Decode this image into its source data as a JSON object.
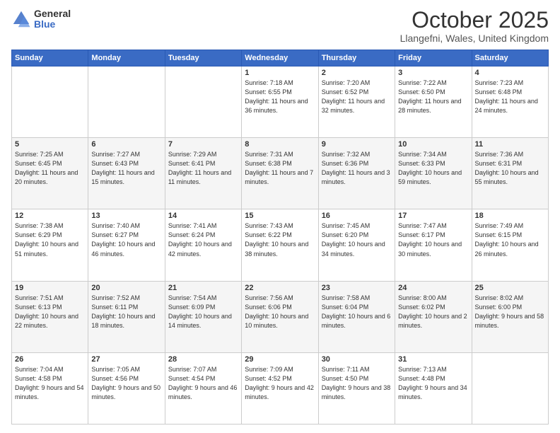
{
  "logo": {
    "general": "General",
    "blue": "Blue"
  },
  "header": {
    "month": "October 2025",
    "location": "Llangefni, Wales, United Kingdom"
  },
  "days_of_week": [
    "Sunday",
    "Monday",
    "Tuesday",
    "Wednesday",
    "Thursday",
    "Friday",
    "Saturday"
  ],
  "weeks": [
    [
      {
        "day": null,
        "sunrise": null,
        "sunset": null,
        "daylight": null
      },
      {
        "day": null,
        "sunrise": null,
        "sunset": null,
        "daylight": null
      },
      {
        "day": null,
        "sunrise": null,
        "sunset": null,
        "daylight": null
      },
      {
        "day": "1",
        "sunrise": "7:18 AM",
        "sunset": "6:55 PM",
        "daylight": "11 hours and 36 minutes."
      },
      {
        "day": "2",
        "sunrise": "7:20 AM",
        "sunset": "6:52 PM",
        "daylight": "11 hours and 32 minutes."
      },
      {
        "day": "3",
        "sunrise": "7:22 AM",
        "sunset": "6:50 PM",
        "daylight": "11 hours and 28 minutes."
      },
      {
        "day": "4",
        "sunrise": "7:23 AM",
        "sunset": "6:48 PM",
        "daylight": "11 hours and 24 minutes."
      }
    ],
    [
      {
        "day": "5",
        "sunrise": "7:25 AM",
        "sunset": "6:45 PM",
        "daylight": "11 hours and 20 minutes."
      },
      {
        "day": "6",
        "sunrise": "7:27 AM",
        "sunset": "6:43 PM",
        "daylight": "11 hours and 15 minutes."
      },
      {
        "day": "7",
        "sunrise": "7:29 AM",
        "sunset": "6:41 PM",
        "daylight": "11 hours and 11 minutes."
      },
      {
        "day": "8",
        "sunrise": "7:31 AM",
        "sunset": "6:38 PM",
        "daylight": "11 hours and 7 minutes."
      },
      {
        "day": "9",
        "sunrise": "7:32 AM",
        "sunset": "6:36 PM",
        "daylight": "11 hours and 3 minutes."
      },
      {
        "day": "10",
        "sunrise": "7:34 AM",
        "sunset": "6:33 PM",
        "daylight": "10 hours and 59 minutes."
      },
      {
        "day": "11",
        "sunrise": "7:36 AM",
        "sunset": "6:31 PM",
        "daylight": "10 hours and 55 minutes."
      }
    ],
    [
      {
        "day": "12",
        "sunrise": "7:38 AM",
        "sunset": "6:29 PM",
        "daylight": "10 hours and 51 minutes."
      },
      {
        "day": "13",
        "sunrise": "7:40 AM",
        "sunset": "6:27 PM",
        "daylight": "10 hours and 46 minutes."
      },
      {
        "day": "14",
        "sunrise": "7:41 AM",
        "sunset": "6:24 PM",
        "daylight": "10 hours and 42 minutes."
      },
      {
        "day": "15",
        "sunrise": "7:43 AM",
        "sunset": "6:22 PM",
        "daylight": "10 hours and 38 minutes."
      },
      {
        "day": "16",
        "sunrise": "7:45 AM",
        "sunset": "6:20 PM",
        "daylight": "10 hours and 34 minutes."
      },
      {
        "day": "17",
        "sunrise": "7:47 AM",
        "sunset": "6:17 PM",
        "daylight": "10 hours and 30 minutes."
      },
      {
        "day": "18",
        "sunrise": "7:49 AM",
        "sunset": "6:15 PM",
        "daylight": "10 hours and 26 minutes."
      }
    ],
    [
      {
        "day": "19",
        "sunrise": "7:51 AM",
        "sunset": "6:13 PM",
        "daylight": "10 hours and 22 minutes."
      },
      {
        "day": "20",
        "sunrise": "7:52 AM",
        "sunset": "6:11 PM",
        "daylight": "10 hours and 18 minutes."
      },
      {
        "day": "21",
        "sunrise": "7:54 AM",
        "sunset": "6:09 PM",
        "daylight": "10 hours and 14 minutes."
      },
      {
        "day": "22",
        "sunrise": "7:56 AM",
        "sunset": "6:06 PM",
        "daylight": "10 hours and 10 minutes."
      },
      {
        "day": "23",
        "sunrise": "7:58 AM",
        "sunset": "6:04 PM",
        "daylight": "10 hours and 6 minutes."
      },
      {
        "day": "24",
        "sunrise": "8:00 AM",
        "sunset": "6:02 PM",
        "daylight": "10 hours and 2 minutes."
      },
      {
        "day": "25",
        "sunrise": "8:02 AM",
        "sunset": "6:00 PM",
        "daylight": "9 hours and 58 minutes."
      }
    ],
    [
      {
        "day": "26",
        "sunrise": "7:04 AM",
        "sunset": "4:58 PM",
        "daylight": "9 hours and 54 minutes."
      },
      {
        "day": "27",
        "sunrise": "7:05 AM",
        "sunset": "4:56 PM",
        "daylight": "9 hours and 50 minutes."
      },
      {
        "day": "28",
        "sunrise": "7:07 AM",
        "sunset": "4:54 PM",
        "daylight": "9 hours and 46 minutes."
      },
      {
        "day": "29",
        "sunrise": "7:09 AM",
        "sunset": "4:52 PM",
        "daylight": "9 hours and 42 minutes."
      },
      {
        "day": "30",
        "sunrise": "7:11 AM",
        "sunset": "4:50 PM",
        "daylight": "9 hours and 38 minutes."
      },
      {
        "day": "31",
        "sunrise": "7:13 AM",
        "sunset": "4:48 PM",
        "daylight": "9 hours and 34 minutes."
      },
      {
        "day": null,
        "sunrise": null,
        "sunset": null,
        "daylight": null
      }
    ]
  ]
}
